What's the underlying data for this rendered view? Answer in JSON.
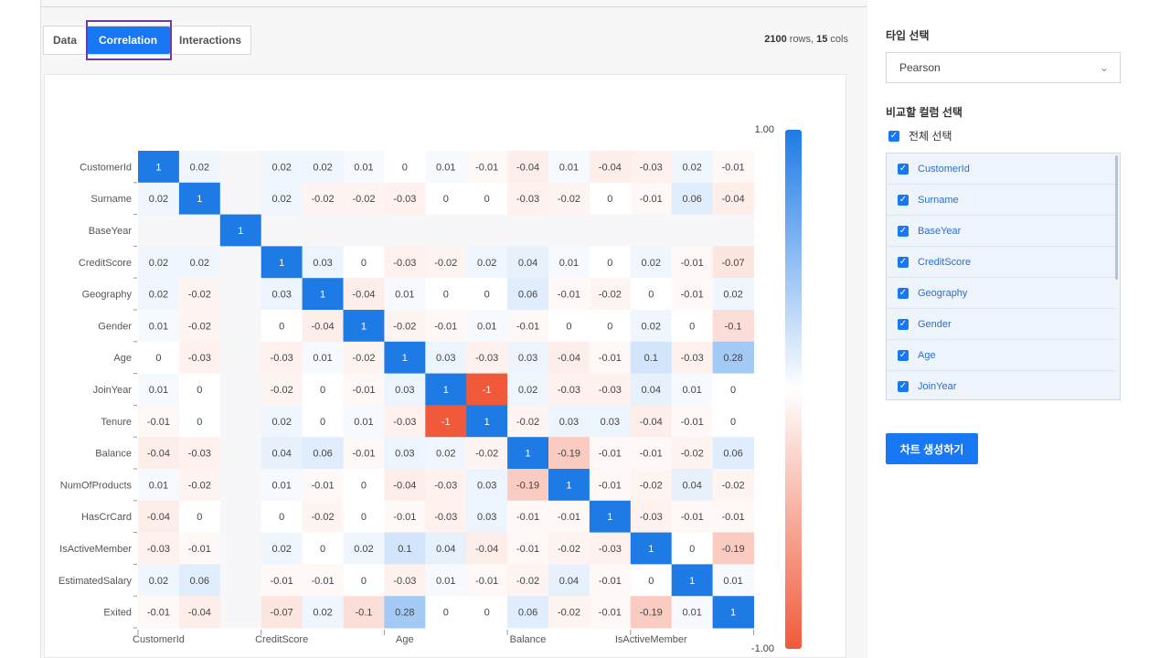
{
  "tabs": [
    {
      "label": "Data",
      "active": false
    },
    {
      "label": "Correlation",
      "active": true
    },
    {
      "label": "Interactions",
      "active": false
    }
  ],
  "summary": {
    "rows": "2100",
    "rows_suffix": " rows, ",
    "cols": "15",
    "cols_suffix": " cols"
  },
  "right_panel": {
    "type_label": "타입 선택",
    "type_value": "Pearson",
    "compare_label": "비교할 컬럼 선택",
    "select_all_label": "전체 선택",
    "columns": [
      "CustomerId",
      "Surname",
      "BaseYear",
      "CreditScore",
      "Geography",
      "Gender",
      "Age",
      "JoinYear"
    ],
    "generate_button": "차트 생성하기"
  },
  "colors": {
    "positive": "#1e7be6",
    "negative": "#f05a3a",
    "accent": "#1877f2",
    "highlight": "#6f3ca7"
  },
  "chart_data": {
    "type": "heatmap",
    "row_labels": [
      "CustomerId",
      "Surname",
      "BaseYear",
      "CreditScore",
      "Geography",
      "Gender",
      "Age",
      "JoinYear",
      "Tenure",
      "Balance",
      "NumOfProducts",
      "HasCrCard",
      "IsActiveMember",
      "EstimatedSalary",
      "Exited"
    ],
    "col_tick_labels": [
      "CustomerId",
      "",
      "",
      "CreditScore",
      "",
      "",
      "Age",
      "",
      "",
      "Balance",
      "",
      "",
      "IsActiveMember",
      "",
      ""
    ],
    "colorbar": {
      "min": -1.0,
      "max": 1.0,
      "min_label": "-1.00",
      "max_label": "1.00"
    },
    "matrix": [
      [
        1,
        0.02,
        null,
        0.02,
        0.02,
        0.01,
        0,
        0.01,
        -0.01,
        -0.04,
        0.01,
        -0.04,
        -0.03,
        0.02,
        -0.01
      ],
      [
        0.02,
        1,
        null,
        0.02,
        -0.02,
        -0.02,
        -0.03,
        0,
        0,
        -0.03,
        -0.02,
        0,
        -0.01,
        0.06,
        -0.04
      ],
      [
        null,
        null,
        1,
        null,
        null,
        null,
        null,
        null,
        null,
        null,
        null,
        null,
        null,
        null,
        null
      ],
      [
        0.02,
        0.02,
        null,
        1,
        0.03,
        0,
        -0.03,
        -0.02,
        0.02,
        0.04,
        0.01,
        0,
        0.02,
        -0.01,
        -0.07
      ],
      [
        0.02,
        -0.02,
        null,
        0.03,
        1,
        -0.04,
        0.01,
        0,
        0,
        0.06,
        -0.01,
        -0.02,
        0,
        -0.01,
        0.02
      ],
      [
        0.01,
        -0.02,
        null,
        0,
        -0.04,
        1,
        -0.02,
        -0.01,
        0.01,
        -0.01,
        0,
        0,
        0.02,
        0,
        -0.1
      ],
      [
        0,
        -0.03,
        null,
        -0.03,
        0.01,
        -0.02,
        1,
        0.03,
        -0.03,
        0.03,
        -0.04,
        -0.01,
        0.1,
        -0.03,
        0.28
      ],
      [
        0.01,
        0,
        null,
        -0.02,
        0,
        -0.01,
        0.03,
        1,
        -1,
        0.02,
        -0.03,
        -0.03,
        0.04,
        0.01,
        0
      ],
      [
        -0.01,
        0,
        null,
        0.02,
        0,
        0.01,
        -0.03,
        -1,
        1,
        -0.02,
        0.03,
        0.03,
        -0.04,
        -0.01,
        0
      ],
      [
        -0.04,
        -0.03,
        null,
        0.04,
        0.06,
        -0.01,
        0.03,
        0.02,
        -0.02,
        1,
        -0.19,
        -0.01,
        -0.01,
        -0.02,
        0.06
      ],
      [
        0.01,
        -0.02,
        null,
        0.01,
        -0.01,
        0,
        -0.04,
        -0.03,
        0.03,
        -0.19,
        1,
        -0.01,
        -0.02,
        0.04,
        -0.02
      ],
      [
        -0.04,
        0,
        null,
        0,
        -0.02,
        0,
        -0.01,
        -0.03,
        0.03,
        -0.01,
        -0.01,
        1,
        -0.03,
        -0.01,
        -0.01
      ],
      [
        -0.03,
        -0.01,
        null,
        0.02,
        0,
        0.02,
        0.1,
        0.04,
        -0.04,
        -0.01,
        -0.02,
        -0.03,
        1,
        0,
        -0.19
      ],
      [
        0.02,
        0.06,
        null,
        -0.01,
        -0.01,
        0,
        -0.03,
        0.01,
        -0.01,
        -0.02,
        0.04,
        -0.01,
        0,
        1,
        0.01
      ],
      [
        -0.01,
        -0.04,
        null,
        -0.07,
        0.02,
        -0.1,
        0.28,
        0,
        0,
        0.06,
        -0.02,
        -0.01,
        -0.19,
        0.01,
        1
      ]
    ]
  }
}
